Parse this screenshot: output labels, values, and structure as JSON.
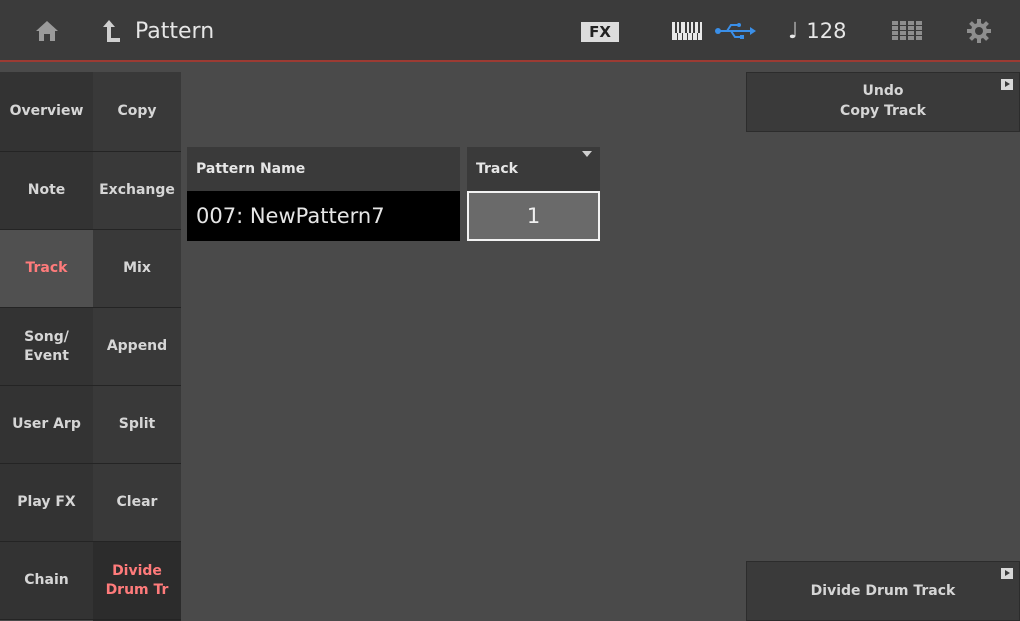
{
  "header": {
    "title": "Pattern",
    "fx_label": "FX",
    "tempo": "128",
    "tempo_note": "♩",
    "icons": [
      "home-icon",
      "back-icon",
      "keyboard-icon",
      "usb-icon",
      "grid-icon",
      "gear-icon"
    ]
  },
  "nav_primary": [
    {
      "label": "Overview",
      "active": false
    },
    {
      "label": "Note",
      "active": false
    },
    {
      "label": "Track",
      "active": true
    },
    {
      "label": "Song/\nEvent",
      "active": false
    },
    {
      "label": "User Arp",
      "active": false
    },
    {
      "label": "Play FX",
      "active": false
    },
    {
      "label": "Chain",
      "active": false
    }
  ],
  "nav_secondary": [
    {
      "label": "Copy",
      "active": false
    },
    {
      "label": "Exchange",
      "active": false
    },
    {
      "label": "Mix",
      "active": false
    },
    {
      "label": "Append",
      "active": false
    },
    {
      "label": "Split",
      "active": false
    },
    {
      "label": "Clear",
      "active": false
    },
    {
      "label": "Divide\nDrum Tr",
      "active": true
    }
  ],
  "main": {
    "pattern_name_label": "Pattern Name",
    "pattern_name_value": "007: NewPattern7",
    "track_label": "Track",
    "track_value": "1"
  },
  "side_buttons": {
    "undo_label": "Undo\nCopy Track",
    "divide_label": "Divide Drum Track"
  },
  "colors": {
    "active_text": "#ff7b7b",
    "header_accent": "#9c3b33",
    "usb_blue": "#3a8fe8"
  }
}
